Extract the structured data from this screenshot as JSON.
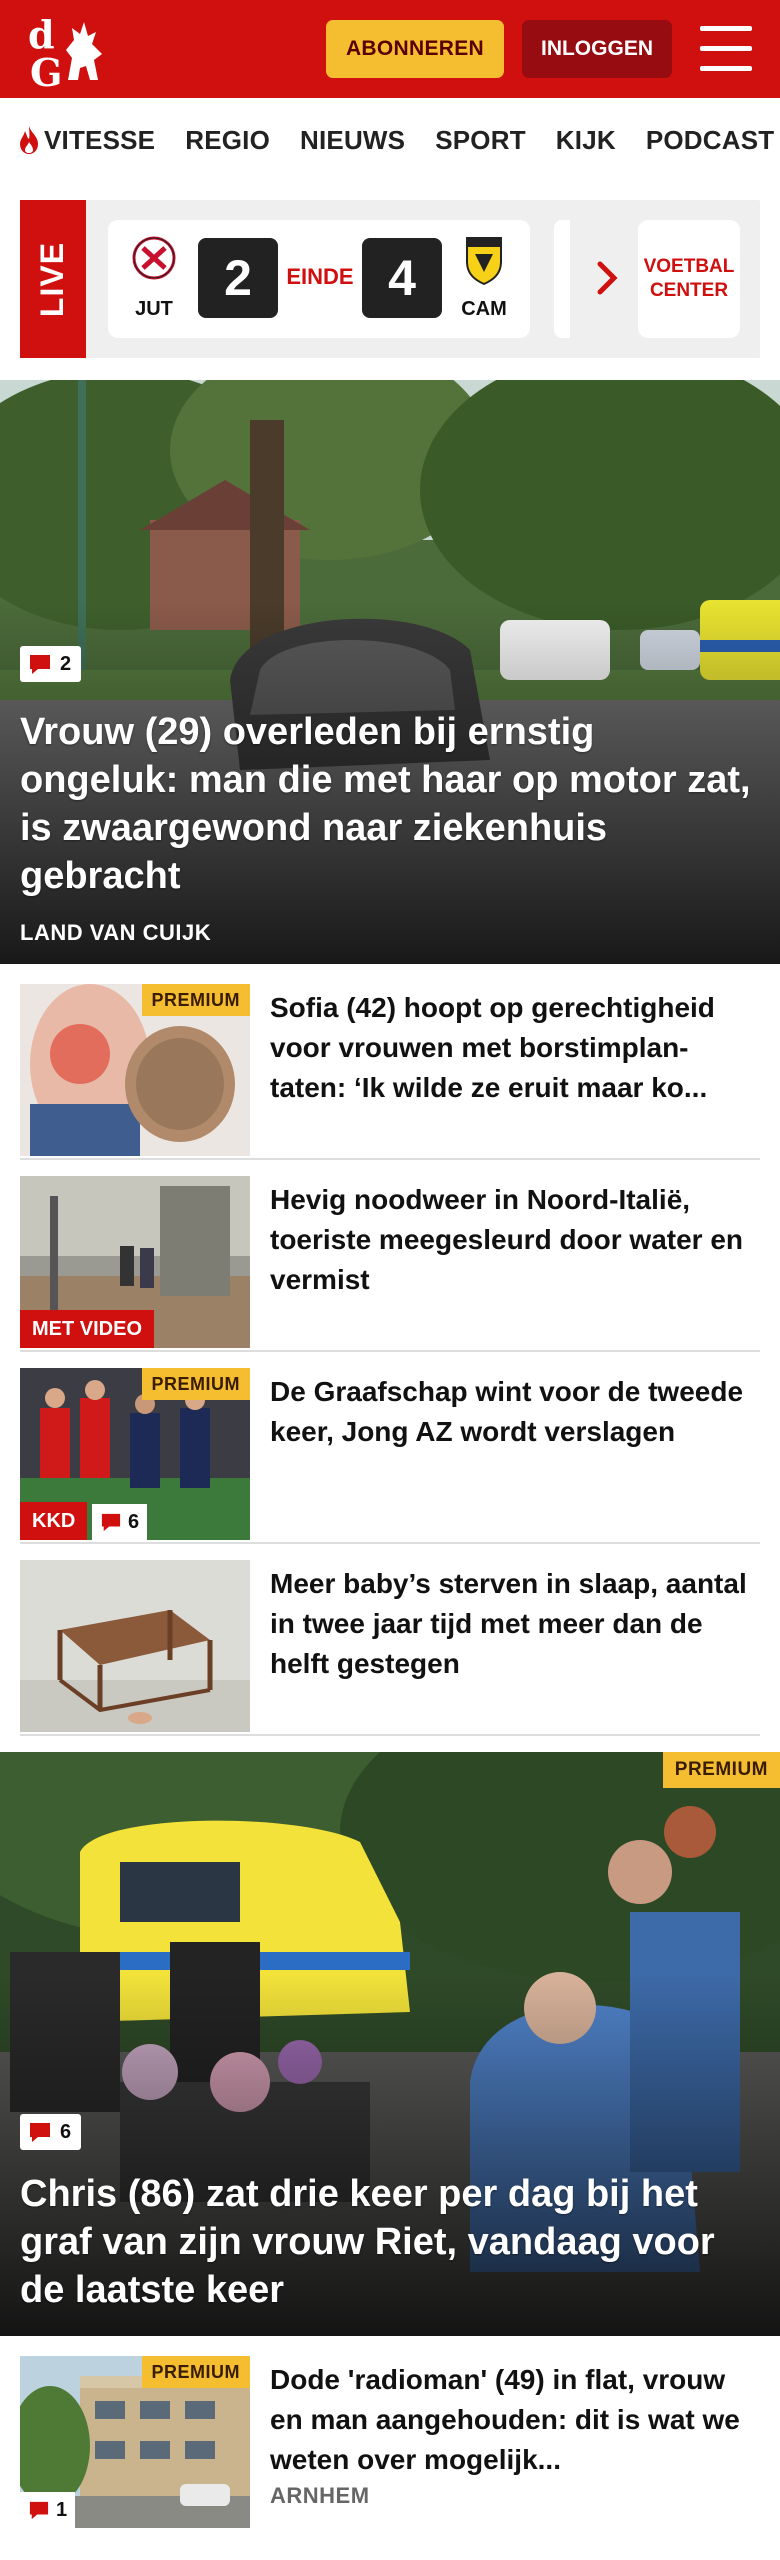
{
  "header": {
    "logo_text": "dG",
    "subscribe_label": "ABONNEREN",
    "login_label": "INLOGGEN",
    "brand_color": "#d00f0f",
    "subscribe_color": "#f5be30"
  },
  "nav": {
    "items": [
      {
        "label": "VITESSE",
        "icon": "flame-icon"
      },
      {
        "label": "REGIO"
      },
      {
        "label": "NIEUWS"
      },
      {
        "label": "SPORT"
      },
      {
        "label": "KIJK"
      },
      {
        "label": "PODCAST"
      }
    ]
  },
  "live": {
    "tag": "LIVE",
    "home_team": "JUT",
    "home_score": "2",
    "status": "EINDE",
    "away_score": "4",
    "away_team": "CAM",
    "voetbal_center_label": "VOETBAL CENTER"
  },
  "hero1": {
    "comment_count": "2",
    "title": "Vrouw (29) overleden bij ernstig ongeluk: man die met haar op motor zat, is zwaargewond naar ziekenhuis gebracht",
    "location": "LAND VAN CUIJK"
  },
  "articles": [
    {
      "title": "Sofia (42) hoopt op gerechtigheid voor vrouwen met borstimplan-taten: ‘Ik wilde ze eruit maar ko...",
      "premium": "PREMIUM"
    },
    {
      "title": "Hevig noodweer in Noord-Italië, toeriste meegesleurd door water en vermist",
      "tag": "MET VIDEO"
    },
    {
      "title": "De Graafschap wint voor de tweede keer, Jong AZ wordt verslagen",
      "premium": "PREMIUM",
      "tag": "KKD",
      "comment_count": "6"
    },
    {
      "title": "Meer baby’s sterven in slaap, aantal in twee jaar tijd met meer dan de helft gestegen"
    }
  ],
  "hero2": {
    "premium": "PREMIUM",
    "comment_count": "6",
    "title": "Chris (86) zat drie keer per dag bij het graf van zijn vrouw Riet, vandaag voor de laatste keer"
  },
  "article_last": {
    "premium": "PREMIUM",
    "comment_count": "1",
    "title": "Dode 'radioman' (49) in flat, vrouw en man aangehouden: dit is wat we weten over mogelijk...",
    "location": "ARNHEM"
  }
}
